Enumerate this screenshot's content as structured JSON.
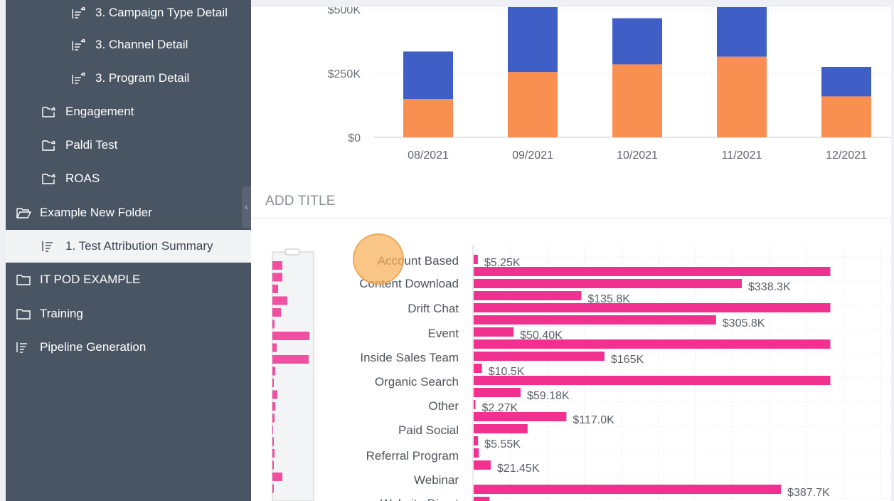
{
  "sidebar": {
    "items": [
      {
        "label": "3. Campaign Type Detail",
        "icon": "detail-report-icon"
      },
      {
        "label": "3. Channel Detail",
        "icon": "detail-report-icon"
      },
      {
        "label": "3. Program Detail",
        "icon": "detail-report-icon"
      },
      {
        "label": "Engagement",
        "icon": "shared-folder-icon"
      },
      {
        "label": "Paldi Test",
        "icon": "shared-folder-icon"
      },
      {
        "label": "ROAS",
        "icon": "shared-folder-icon"
      },
      {
        "label": "Example New Folder",
        "icon": "open-folder-icon"
      },
      {
        "label": "1. Test Attribution Summary",
        "icon": "report-icon",
        "selected": true
      },
      {
        "label": "IT POD EXAMPLE",
        "icon": "folder-icon"
      },
      {
        "label": "Training",
        "icon": "folder-icon"
      },
      {
        "label": "Pipeline Generation",
        "icon": "report-icon"
      }
    ],
    "collapse_icon": "chevron-left-icon"
  },
  "colors": {
    "sidebar_bg": "#4a5563",
    "series_blue": "#3f5fc6",
    "series_orange": "#fa8f52",
    "bar_pink": "#f0318f",
    "cursor": "#f6b05a"
  },
  "main": {
    "section_title": "ADD TITLE"
  },
  "chart_data": [
    {
      "type": "bar",
      "stacked": true,
      "categories": [
        "08/2021",
        "09/2021",
        "10/2021",
        "11/2021",
        "12/2021"
      ],
      "series": [
        {
          "color": "#fa8f52",
          "values": [
            150,
            255,
            285,
            315,
            160
          ]
        },
        {
          "color": "#3f5fc6",
          "values": [
            185,
            295,
            180,
            230,
            115
          ]
        }
      ],
      "ytick_labels": [
        "$0",
        "$250K",
        "$500K"
      ],
      "yticks": [
        0,
        250,
        500
      ],
      "ylim": [
        0,
        500
      ],
      "grid": true
    },
    {
      "type": "bar",
      "orientation": "horizontal",
      "categories": [
        "Account Based",
        "Content Download",
        "Drift Chat",
        "Event",
        "Inside Sales Team",
        "Organic Search",
        "Other",
        "Paid Social",
        "Referral Program",
        "Webinar",
        "Website Direct"
      ],
      "bars": [
        {
          "value": 5.25,
          "label": "$5.25K"
        },
        {
          "value": 450,
          "label": ""
        },
        {
          "value": 338.3,
          "label": "$338.3K"
        },
        {
          "value": 135.8,
          "label": "$135.8K"
        },
        {
          "value": 450,
          "label": ""
        },
        {
          "value": 305.8,
          "label": "$305.8K"
        },
        {
          "value": 50.4,
          "label": "$50.40K"
        },
        {
          "value": 450,
          "label": ""
        },
        {
          "value": 165,
          "label": "$165K"
        },
        {
          "value": 10.5,
          "label": "$10.5K"
        },
        {
          "value": 450,
          "label": ""
        },
        {
          "value": 59.18,
          "label": "$59.18K"
        },
        {
          "value": 2.27,
          "label": "$2.27K"
        },
        {
          "value": 117.0,
          "label": "$117.0K"
        },
        {
          "value": 68,
          "label": ""
        },
        {
          "value": 5.55,
          "label": "$5.55K"
        },
        {
          "value": 6.5,
          "label": ""
        },
        {
          "value": 21.45,
          "label": "$21.45K"
        },
        {
          "value": 387.7,
          "label": "$387.7K"
        },
        {
          "value": 20,
          "label": ""
        }
      ],
      "overview_scrollbar": {
        "visible": true
      },
      "grid": true
    }
  ]
}
